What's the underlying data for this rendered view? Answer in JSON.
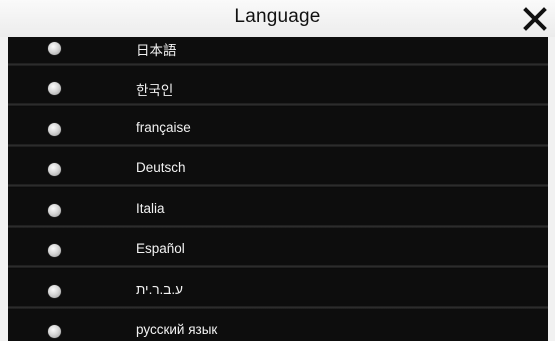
{
  "dialog": {
    "title": "Language",
    "close_icon": "close-icon"
  },
  "languages": [
    {
      "label": "日本語",
      "selected": false
    },
    {
      "label": "한국인",
      "selected": false
    },
    {
      "label": "française",
      "selected": false
    },
    {
      "label": "Deutsch",
      "selected": false
    },
    {
      "label": "Italia",
      "selected": false
    },
    {
      "label": "Español",
      "selected": false
    },
    {
      "label": "ע.ב.ר.ית",
      "selected": false
    },
    {
      "label": "русский язык",
      "selected": false
    }
  ],
  "colors": {
    "list_background": "#0b0b0b",
    "title_background": "#f1f1f1",
    "text": "#f2f2f2"
  }
}
